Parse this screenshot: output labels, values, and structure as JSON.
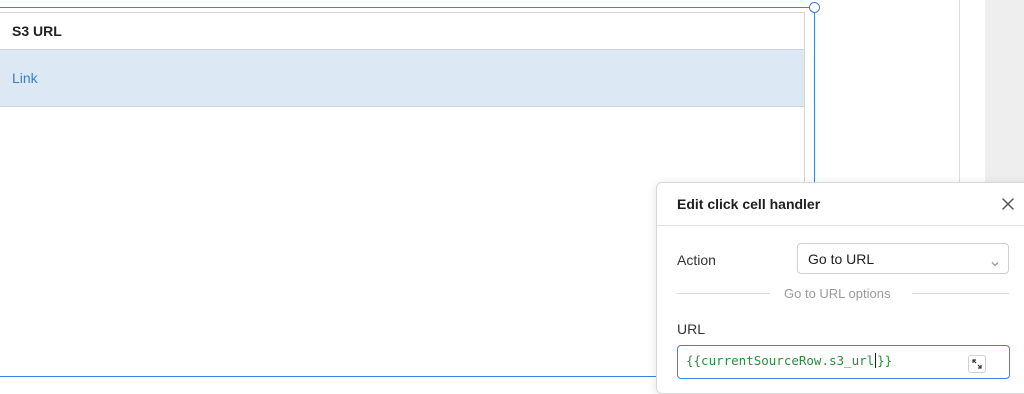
{
  "table": {
    "column_header": "S3 URL",
    "rows": [
      {
        "s3_url": "Link"
      }
    ]
  },
  "popover": {
    "title": "Edit click cell handler",
    "action_label": "Action",
    "action_value": "Go to URL",
    "section_divider": "Go to URL options",
    "url_label": "URL",
    "url_value_before_caret": "{{currentSourceRow.s3_url",
    "url_value_after_caret": "}}"
  },
  "icons": {
    "close": "close-icon",
    "dropdown": "chevron-down-icon",
    "expand": "expand-editor-icon"
  },
  "colors": {
    "selection_accent": "#3c82e0",
    "row_highlight": "#dde8f5",
    "link": "#3a7fc4",
    "code_text": "#2e8b3e"
  }
}
